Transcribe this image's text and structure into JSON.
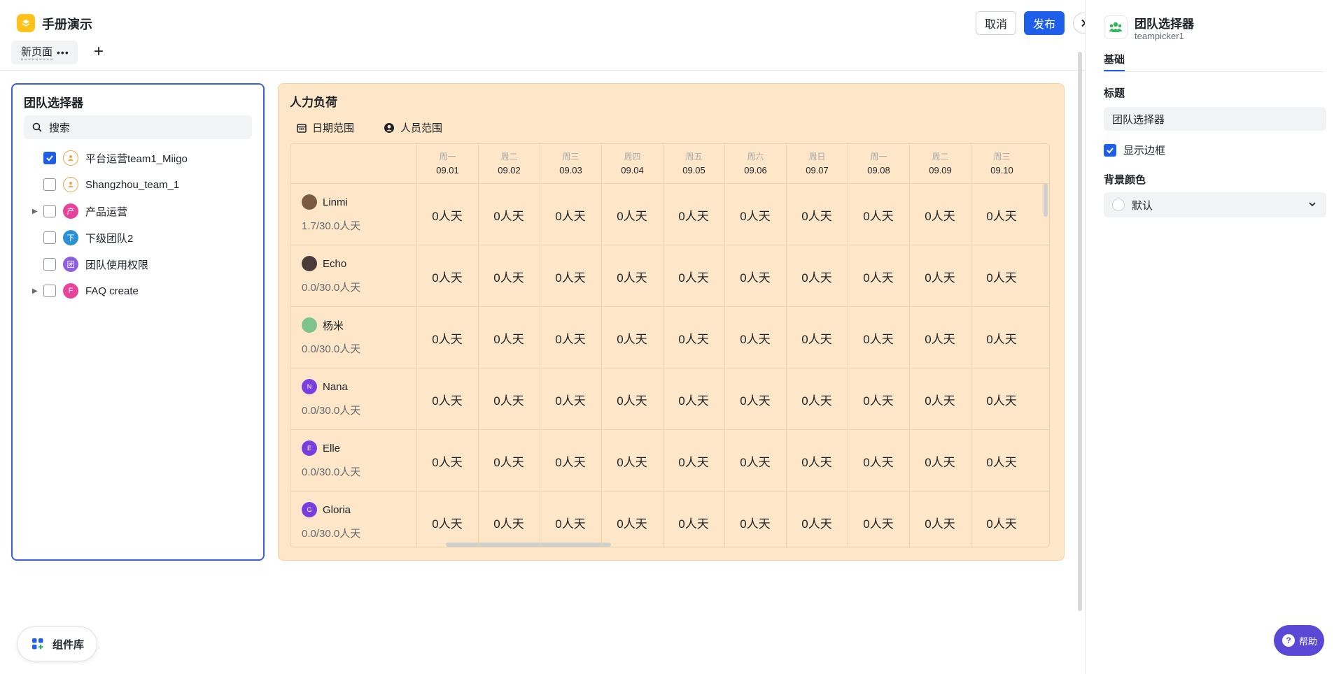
{
  "app": {
    "title": "手册演示",
    "cancel_label": "取消",
    "publish_label": "发布"
  },
  "pages": {
    "tab_label": "新页面",
    "more": "•••",
    "add": "+"
  },
  "picker": {
    "title": "团队选择器",
    "search_placeholder": "搜索",
    "items": [
      {
        "label": "平台运营team1_Miigo",
        "checked": true,
        "expandable": false,
        "icon_text": "",
        "icon_color": "#f0a24a"
      },
      {
        "label": "Shangzhou_team_1",
        "checked": false,
        "expandable": false,
        "icon_text": "",
        "icon_color": "#f0a24a"
      },
      {
        "label": "产品运营",
        "checked": false,
        "expandable": true,
        "icon_text": "产",
        "icon_color": "#e8439a"
      },
      {
        "label": "下级团队2",
        "checked": false,
        "expandable": false,
        "icon_text": "下",
        "icon_color": "#2d91d6"
      },
      {
        "label": "团队使用权限",
        "checked": false,
        "expandable": false,
        "icon_text": "团",
        "icon_color": "#8d5fe0"
      },
      {
        "label": "FAQ create",
        "checked": false,
        "expandable": true,
        "icon_text": "F",
        "icon_color": "#e8439a"
      }
    ]
  },
  "workload": {
    "title": "人力负荷",
    "date_filter": "日期范围",
    "people_filter": "人员范围",
    "columns": [
      {
        "day": "周一",
        "date": "09.01"
      },
      {
        "day": "周二",
        "date": "09.02"
      },
      {
        "day": "周三",
        "date": "09.03"
      },
      {
        "day": "周四",
        "date": "09.04"
      },
      {
        "day": "周五",
        "date": "09.05"
      },
      {
        "day": "周六",
        "date": "09.06"
      },
      {
        "day": "周日",
        "date": "09.07"
      },
      {
        "day": "周一",
        "date": "09.08"
      },
      {
        "day": "周二",
        "date": "09.09"
      },
      {
        "day": "周三",
        "date": "09.10"
      }
    ],
    "cell_value": "0人天",
    "people": [
      {
        "name": "Linmi",
        "load": "1.7/30.0人天",
        "avatar_text": "",
        "avatar_color": "#7a5a40"
      },
      {
        "name": "Echo",
        "load": "0.0/30.0人天",
        "avatar_text": "",
        "avatar_color": "#4a3a3a"
      },
      {
        "name": "杨米",
        "load": "0.0/30.0人天",
        "avatar_text": "",
        "avatar_color": "#7cc48a"
      },
      {
        "name": "Nana",
        "load": "0.0/30.0人天",
        "avatar_text": "N",
        "avatar_color": "#7a3ee0"
      },
      {
        "name": "Elle",
        "load": "0.0/30.0人天",
        "avatar_text": "E",
        "avatar_color": "#7a3ee0"
      },
      {
        "name": "Gloria",
        "load": "0.0/30.0人天",
        "avatar_text": "G",
        "avatar_color": "#7a3ee0"
      }
    ]
  },
  "component_lib": {
    "label": "组件库"
  },
  "panel": {
    "title": "团队选择器",
    "subtitle": "teampicker1",
    "tab": "基础",
    "title_label": "标题",
    "title_value": "团队选择器",
    "show_border_label": "显示边框",
    "show_border": true,
    "bg_label": "背景颜色",
    "bg_value": "默认"
  },
  "help": {
    "label": "帮助"
  },
  "colors": {
    "accent": "#1f5ee8",
    "workload_bg": "#fde7c8",
    "picker_border": "#3b5fd9"
  }
}
